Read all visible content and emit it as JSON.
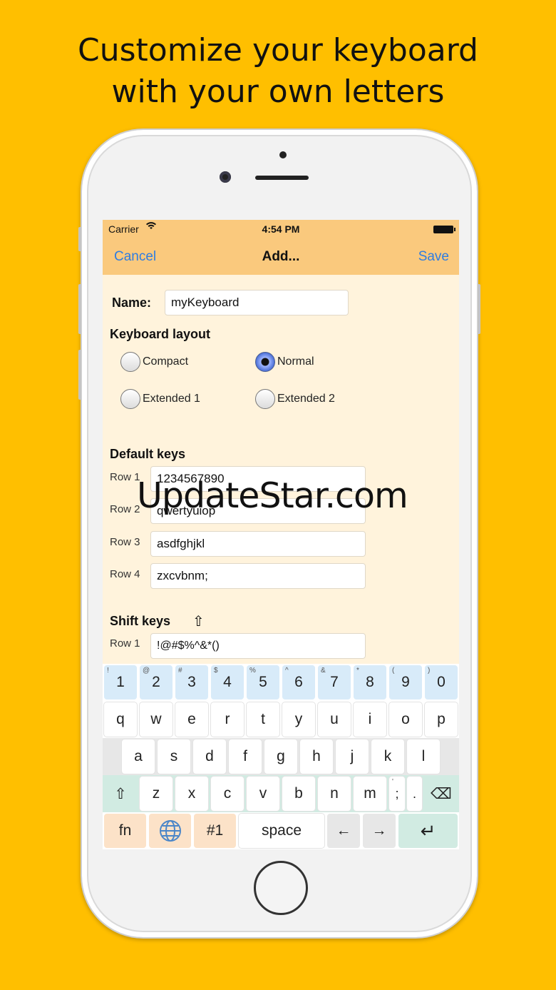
{
  "headline": {
    "line1": "Customize your keyboard",
    "line2": "with your own letters"
  },
  "status_bar": {
    "carrier": "Carrier",
    "time": "4:54 PM"
  },
  "nav": {
    "cancel": "Cancel",
    "title": "Add...",
    "save": "Save"
  },
  "form": {
    "name_label": "Name:",
    "name_value": "myKeyboard",
    "layout_heading": "Keyboard layout",
    "layouts": [
      {
        "label": "Compact",
        "selected": false
      },
      {
        "label": "Normal",
        "selected": true
      },
      {
        "label": "Extended 1",
        "selected": false
      },
      {
        "label": "Extended 2",
        "selected": false
      }
    ],
    "default_keys_heading": "Default keys",
    "default_rows": [
      {
        "label": "Row 1",
        "value": "1234567890"
      },
      {
        "label": "Row 2",
        "value": "qwertyuiop"
      },
      {
        "label": "Row 3",
        "value": "asdfghjkl"
      },
      {
        "label": "Row 4",
        "value": "zxcvbnm;"
      }
    ],
    "shift_keys_heading": "Shift keys",
    "shift_icon": "⇧",
    "shift_rows": [
      {
        "label": "Row 1",
        "value": "!@#$%^&*()"
      }
    ]
  },
  "watermark": "UpdateStar.com",
  "keyboard": {
    "number_row": [
      {
        "main": "1",
        "sub": "!"
      },
      {
        "main": "2",
        "sub": "@"
      },
      {
        "main": "3",
        "sub": "#"
      },
      {
        "main": "4",
        "sub": "$"
      },
      {
        "main": "5",
        "sub": "%"
      },
      {
        "main": "6",
        "sub": "^"
      },
      {
        "main": "7",
        "sub": "&"
      },
      {
        "main": "8",
        "sub": "*"
      },
      {
        "main": "9",
        "sub": "("
      },
      {
        "main": "0",
        "sub": ")"
      }
    ],
    "row1": [
      "q",
      "w",
      "e",
      "r",
      "t",
      "y",
      "u",
      "i",
      "o",
      "p"
    ],
    "row2": [
      "a",
      "s",
      "d",
      "f",
      "g",
      "h",
      "j",
      "k",
      "l"
    ],
    "row3": [
      "z",
      "x",
      "c",
      "v",
      "b",
      "n",
      "m",
      ";",
      "."
    ],
    "row3_semicolon_sub": "'",
    "shift_key": "⇧",
    "backspace_key": "⌫",
    "fn_key": "fn",
    "globe_key": "globe-icon",
    "symbols_key": "#1",
    "space_key": "space",
    "left_arrow_key": "←",
    "right_arrow_key": "→",
    "return_key": "↵"
  },
  "colors": {
    "background": "#FFBF00",
    "nav_bar": "#FAC97D",
    "screen": "#FFF3DC",
    "link_blue": "#2F7DE1",
    "number_key": "#D8EBF9",
    "mint_key": "#D1EBE2",
    "peach_key": "#FCE2C8"
  }
}
